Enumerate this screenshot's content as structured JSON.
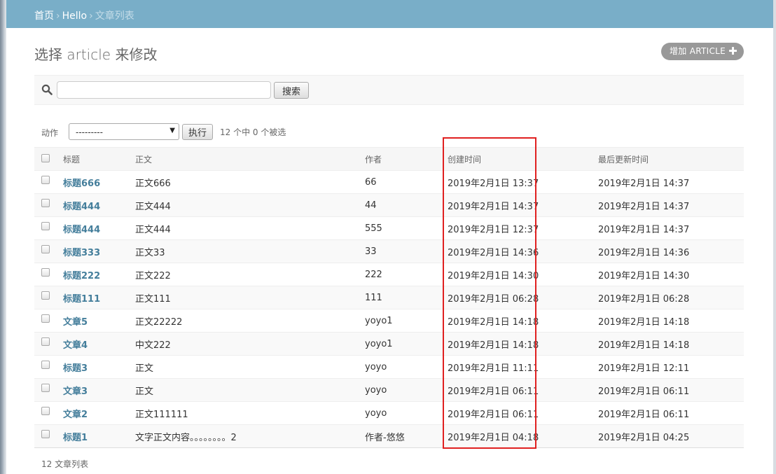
{
  "breadcrumbs": {
    "home": "首页",
    "app": "Hello",
    "current": "文章列表",
    "separator": "›"
  },
  "page": {
    "title": "选择 article 来修改",
    "add_button": "增加 ARTICLE",
    "add_icon": "plus-icon"
  },
  "search": {
    "value": "",
    "button": "搜索"
  },
  "actions": {
    "label": "动作",
    "selected": "---------",
    "go_button": "执行",
    "counter": "12 个中 0 个被选"
  },
  "table": {
    "headers": [
      "标题",
      "正文",
      "作者",
      "创建时间",
      "最后更新时间"
    ],
    "rows": [
      {
        "title": "标题666",
        "body": "正文666",
        "author": "66",
        "created": "2019年2月1日 13:37",
        "updated": "2019年2月1日 14:37"
      },
      {
        "title": "标题444",
        "body": "正文444",
        "author": "44",
        "created": "2019年2月1日 14:37",
        "updated": "2019年2月1日 14:37"
      },
      {
        "title": "标题444",
        "body": "正文444",
        "author": "555",
        "created": "2019年2月1日 12:37",
        "updated": "2019年2月1日 14:37"
      },
      {
        "title": "标题333",
        "body": "正文33",
        "author": "33",
        "created": "2019年2月1日 14:36",
        "updated": "2019年2月1日 14:36"
      },
      {
        "title": "标题222",
        "body": "正文222",
        "author": "222",
        "created": "2019年2月1日 14:30",
        "updated": "2019年2月1日 14:30"
      },
      {
        "title": "标题111",
        "body": "正文111",
        "author": "111",
        "created": "2019年2月1日 06:28",
        "updated": "2019年2月1日 06:28"
      },
      {
        "title": "文章5",
        "body": "正文22222",
        "author": "yoyo1",
        "created": "2019年2月1日 14:18",
        "updated": "2019年2月1日 14:18"
      },
      {
        "title": "文章4",
        "body": "中文222",
        "author": "yoyo1",
        "created": "2019年2月1日 14:18",
        "updated": "2019年2月1日 14:18"
      },
      {
        "title": "标题3",
        "body": "正文",
        "author": "yoyo",
        "created": "2019年2月1日 11:11",
        "updated": "2019年2月1日 12:11"
      },
      {
        "title": "文章3",
        "body": "正文",
        "author": "yoyo",
        "created": "2019年2月1日 06:11",
        "updated": "2019年2月1日 06:11"
      },
      {
        "title": "文章2",
        "body": "正文111111",
        "author": "yoyo",
        "created": "2019年2月1日 06:11",
        "updated": "2019年2月1日 06:11"
      },
      {
        "title": "标题1",
        "body": "文字正文内容。。。。。。。。2",
        "author": "作者-悠悠",
        "created": "2019年2月1日 04:18",
        "updated": "2019年2月1日 04:25"
      }
    ]
  },
  "paginator": "12 文章列表",
  "colors": {
    "header": "#79aec8",
    "link": "#447e9b",
    "highlight": "#e02020"
  }
}
